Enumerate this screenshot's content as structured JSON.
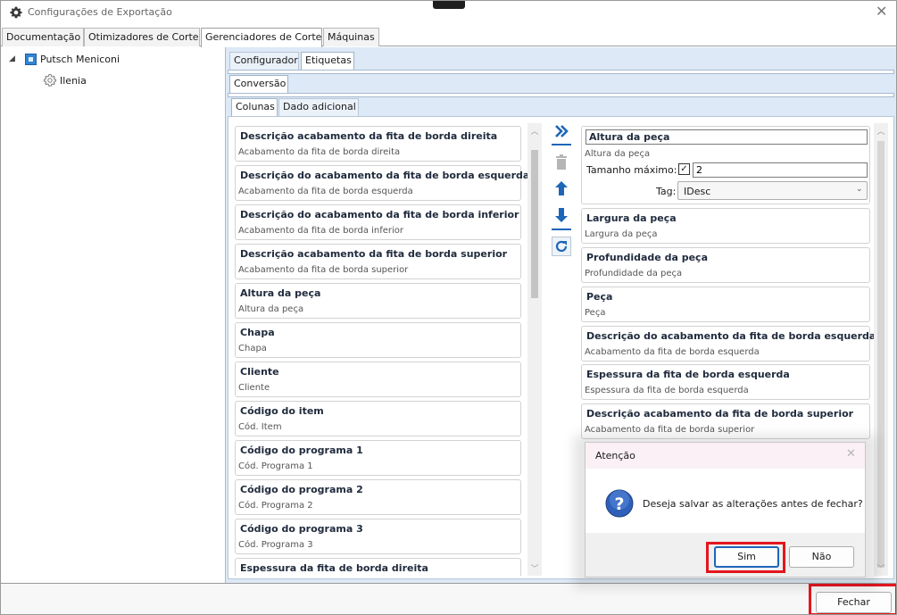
{
  "window": {
    "title": "Configurações de Exportação",
    "close_symbol": "✕"
  },
  "main_tabs": [
    {
      "label": "Documentação",
      "active": false
    },
    {
      "label": "Otimizadores de Corte",
      "active": false
    },
    {
      "label": "Gerenciadores de Corte",
      "active": true
    },
    {
      "label": "Máquinas",
      "active": false
    }
  ],
  "tree": {
    "root": {
      "label": "Putsch Meniconi",
      "icon": "cube-icon",
      "expanded": true
    },
    "child": {
      "label": "Ilenia",
      "icon": "gear-icon",
      "selected": true
    }
  },
  "sub_tabs": [
    {
      "label": "Configurador",
      "active": false
    },
    {
      "label": "Etiquetas",
      "active": true
    }
  ],
  "conversion_tab": {
    "label": "Conversão"
  },
  "column_tabs": [
    {
      "label": "Colunas",
      "active": true
    },
    {
      "label": "Dado adicional",
      "active": false
    }
  ],
  "available_columns": [
    {
      "title": "Descrição acabamento da fita de borda direita",
      "subtitle": "Acabamento da fita de borda direita"
    },
    {
      "title": "Descrição do acabamento da fita de borda esquerda",
      "subtitle": "Acabamento da fita de borda esquerda"
    },
    {
      "title": "Descrição do acabamento da fita de borda inferior",
      "subtitle": "Acabamento da fita de borda inferior"
    },
    {
      "title": "Descrição acabamento da fita de borda superior",
      "subtitle": "Acabamento da fita de borda superior"
    },
    {
      "title": "Altura da peça",
      "subtitle": "Altura da peça"
    },
    {
      "title": "Chapa",
      "subtitle": "Chapa"
    },
    {
      "title": "Cliente",
      "subtitle": "Cliente"
    },
    {
      "title": "Código do item",
      "subtitle": "Cód. Item"
    },
    {
      "title": "Código do programa 1",
      "subtitle": "Cód. Programa 1"
    },
    {
      "title": "Código do programa 2",
      "subtitle": "Cód. Programa 2"
    },
    {
      "title": "Código do programa 3",
      "subtitle": "Cód. Programa 3"
    },
    {
      "title": "Espessura da fita de borda direita",
      "subtitle": ""
    }
  ],
  "selected_column": {
    "title_value": "Altura da peça",
    "subtitle": "Altura da peça",
    "max_size_label": "Tamanho máximo:",
    "max_size_checked": true,
    "max_size_value": "2",
    "tag_label": "Tag:",
    "tag_value": "IDesc"
  },
  "chosen_columns": [
    {
      "title": "Largura da peça",
      "subtitle": "Largura da peça"
    },
    {
      "title": "Profundidade da peça",
      "subtitle": "Profundidade da peça"
    },
    {
      "title": "Peça",
      "subtitle": "Peça"
    },
    {
      "title": "Descrição do acabamento da fita de borda esquerda",
      "subtitle": "Acabamento da fita de borda esquerda"
    },
    {
      "title": "Espessura da fita de borda esquerda",
      "subtitle": "Espessura da fita de borda esquerda"
    },
    {
      "title": "Descrição acabamento da fita de borda superior",
      "subtitle": "Acabamento da fita de borda superior"
    }
  ],
  "middle_buttons": [
    {
      "icon": "double-chevron-right-icon",
      "enabled": true
    },
    {
      "icon": "trash-icon",
      "enabled": false
    },
    {
      "icon": "arrow-up-icon",
      "enabled": true
    },
    {
      "icon": "arrow-down-icon",
      "enabled": true
    },
    {
      "icon": "refresh-icon",
      "enabled": true
    }
  ],
  "dialog": {
    "title": "Atenção",
    "message": "Deseja salvar as alterações antes de fechar?",
    "yes_label": "Sim",
    "no_label": "Não",
    "icon": "question-icon"
  },
  "footer": {
    "close_label": "Fechar"
  },
  "colors": {
    "accent": "#1d66b8",
    "highlight": "#e4161e",
    "pane_bg": "#dde9f6"
  }
}
